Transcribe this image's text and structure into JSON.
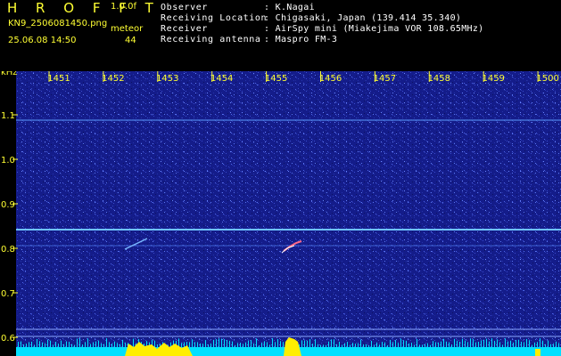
{
  "header": {
    "brand": "H R O F F T",
    "version": "1.0.0f",
    "filename": "KN9_2506081450.png",
    "meteor_label": "meteor",
    "datetime": "25.06.08 14:50",
    "meteor_count": "44"
  },
  "info": [
    {
      "label": "Observer",
      "value": ": K.Nagai"
    },
    {
      "label": "Receiving Location",
      "value": ": Chigasaki, Japan (139.414 35.340)"
    },
    {
      "label": "Receiver",
      "value": ": AirSpy mini (Miakejima VOR 108.65MHz)"
    },
    {
      "label": "Receiving antenna",
      "value": ": Maspro FM-3"
    }
  ],
  "spectrogram": {
    "x_unit": "kHz",
    "x_ticks": [
      "1451",
      "1452",
      "1453",
      "1454",
      "1455",
      "1456",
      "1457",
      "1458",
      "1459",
      "1500"
    ],
    "y_unit": "kHz",
    "y_ticks": [
      "1.1",
      "1.0",
      "0.9",
      "0.8",
      "0.7",
      "0.6"
    ],
    "colors": {
      "background": "#141c8a",
      "axis_text": "#ffff33",
      "carrier_line": "#5ab0ff",
      "level_bar": "#00e0ff",
      "peak": "#ffee00"
    }
  }
}
